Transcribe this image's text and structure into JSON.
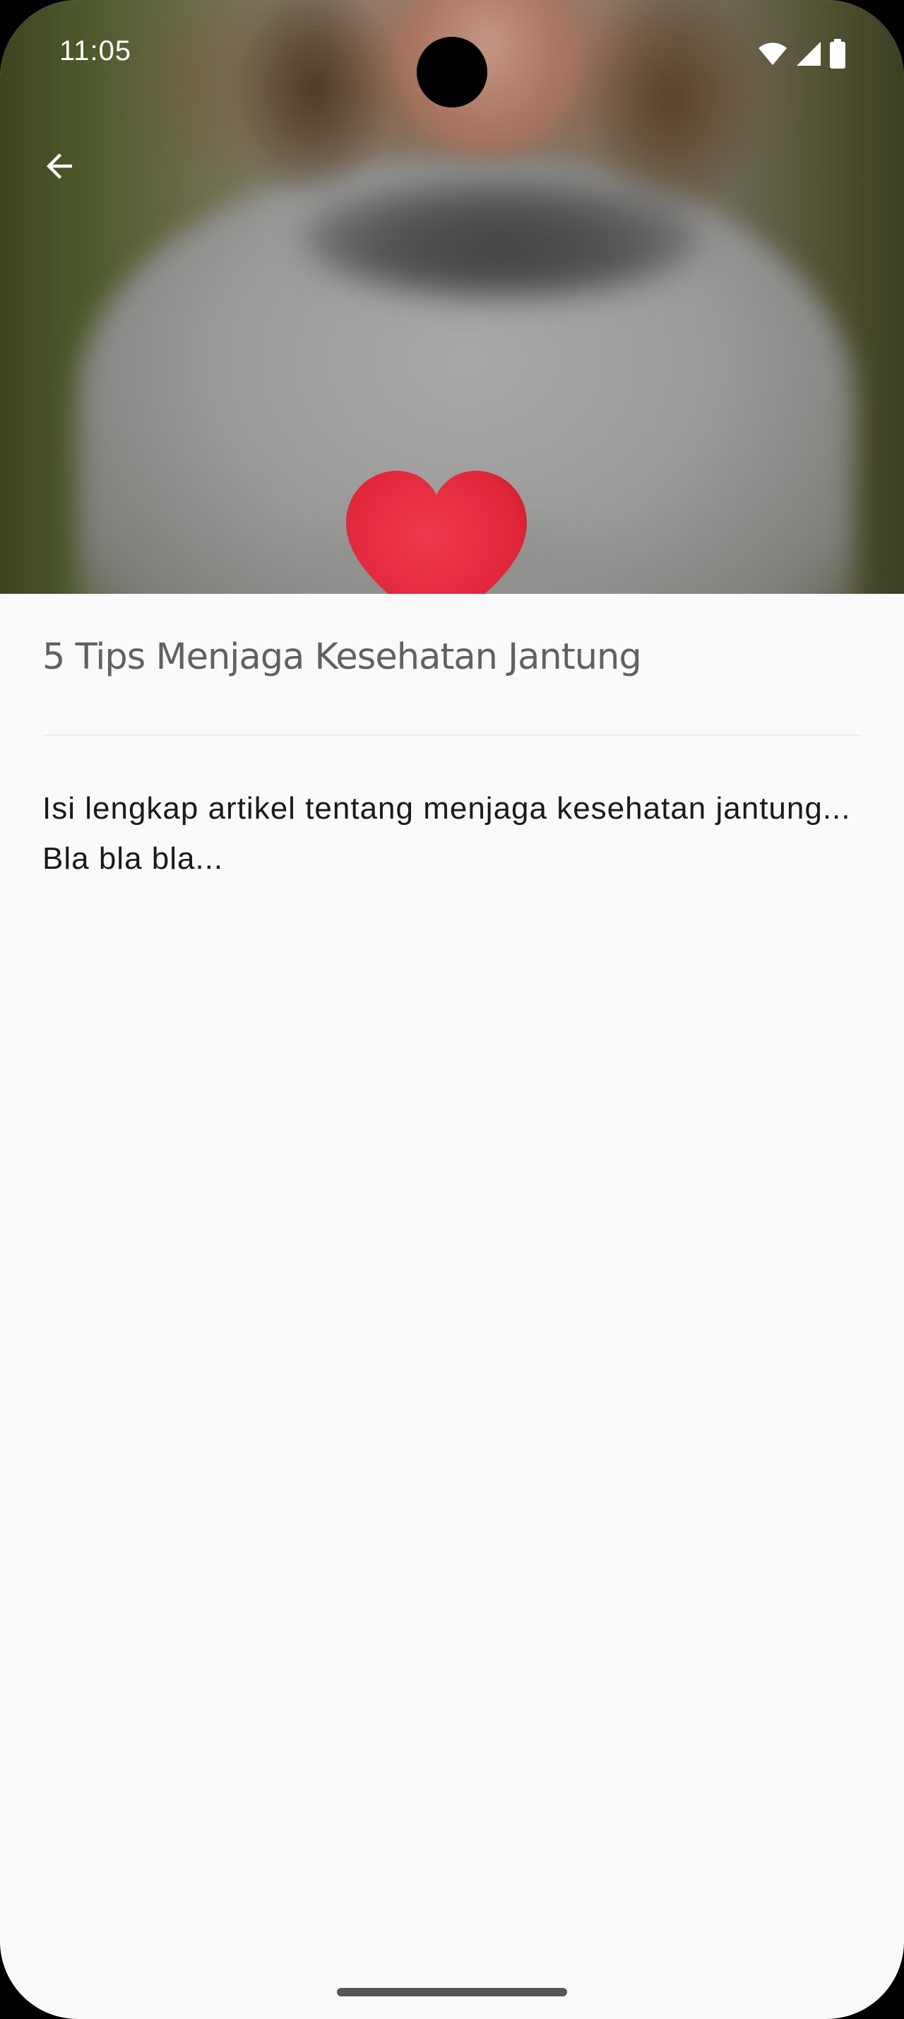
{
  "status_bar": {
    "time": "11:05",
    "icons": [
      "wifi-icon",
      "cellular-signal-icon",
      "battery-icon"
    ]
  },
  "app_bar": {
    "back_icon": "arrow-back-icon"
  },
  "hero_image": {
    "subject": "person in grey sweater holding red felt heart"
  },
  "article": {
    "title": "5 Tips Menjaga Kesehatan Jantung",
    "body": "Isi lengkap artikel tentang menjaga kesehatan jantung... Bla bla bla..."
  },
  "colors": {
    "background": "#fafafa",
    "title_text": "#616161",
    "body_text": "#1a1a1a",
    "divider": "#eeeeee",
    "heart": "#e1263a"
  }
}
